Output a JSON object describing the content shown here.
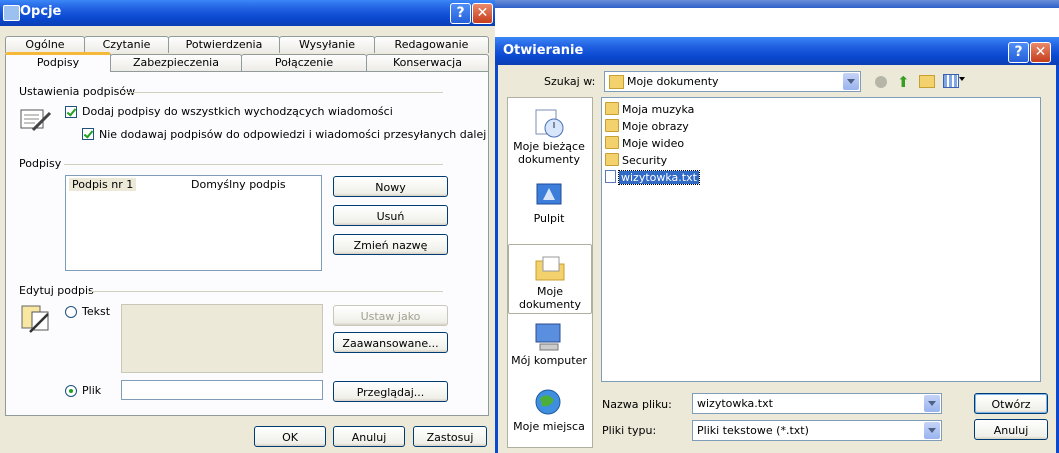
{
  "opcje": {
    "title": "Opcje",
    "tabs_row1": [
      "Ogólne",
      "Czytanie",
      "Potwierdzenia",
      "Wysyłanie",
      "Redagowanie"
    ],
    "tabs_row2": [
      "Podpisy",
      "Zabezpieczenia",
      "Połączenie",
      "Konserwacja"
    ],
    "sig_settings": {
      "label": "Ustawienia podpisów",
      "add_all": "Dodaj podpisy do wszystkich wychodzących wiadomości",
      "no_reply": "Nie dodawaj podpisów do odpowiedzi i wiadomości przesyłanych dalej"
    },
    "signatures": {
      "label": "Podpisy",
      "row_name": "Podpis nr 1",
      "row_default": "Domyślny podpis",
      "new_label": "Nowy",
      "delete_label": "Usuń",
      "rename_label": "Zmień nazwę"
    },
    "edit": {
      "label": "Edytuj podpis",
      "text_label": "Tekst",
      "set_default_label": "Ustaw jako domyślny",
      "advanced_label": "Zaawansowane...",
      "file_label": "Plik",
      "file_value": "",
      "browse_label": "Przeglądaj..."
    },
    "ok_label": "OK",
    "cancel_label": "Anuluj",
    "apply_label": "Zastosuj"
  },
  "open": {
    "title": "Otwieranie",
    "look_in_label": "Szukaj w:",
    "look_in_value": "Moje dokumenty",
    "places": [
      "Moje bieżące dokumenty",
      "Pulpit",
      "Moje dokumenty",
      "Mój komputer",
      "Moje miejsca"
    ],
    "files": [
      {
        "name": "Moja muzyka",
        "icon": "music-folder-icon"
      },
      {
        "name": "Moje obrazy",
        "icon": "pictures-folder-icon"
      },
      {
        "name": "Moje wideo",
        "icon": "video-folder-icon"
      },
      {
        "name": "Security",
        "icon": "folder-icon"
      },
      {
        "name": "wizytowka.txt",
        "icon": "text-file-icon"
      }
    ],
    "filename_label": "Nazwa pliku:",
    "filename_value": "wizytowka.txt",
    "filetype_label": "Pliki typu:",
    "filetype_value": "Pliki tekstowe (*.txt)",
    "open_label": "Otwórz",
    "cancel_label": "Anuluj"
  },
  "colors": {
    "titlebar": "#0a48d0",
    "window_bg": "#ece9d8",
    "selection": "#316ac5",
    "tab_highlight": "#f6b838"
  }
}
